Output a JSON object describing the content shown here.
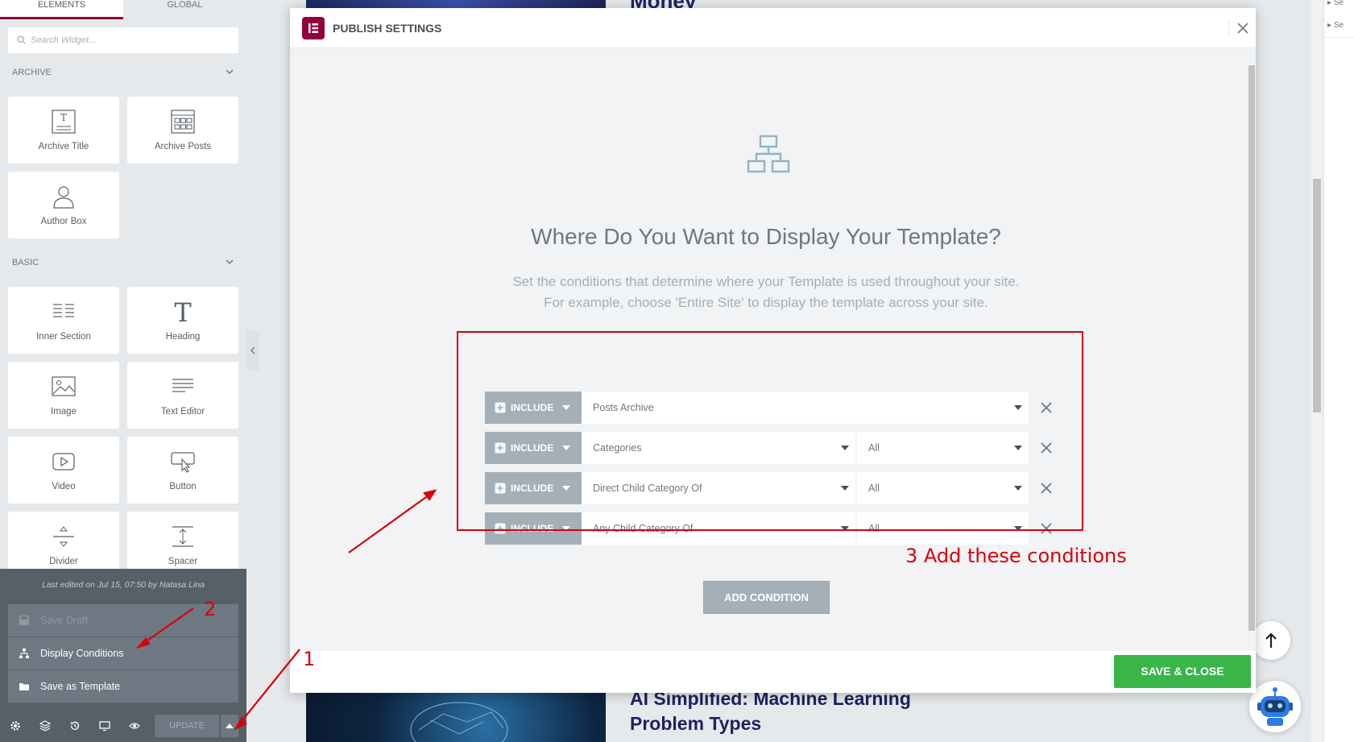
{
  "left_panel": {
    "tabs": [
      {
        "label": "Elements",
        "active": true
      },
      {
        "label": "Global",
        "active": false
      }
    ],
    "search_placeholder": "Search Widget...",
    "categories": [
      {
        "label": "Archive",
        "widgets": [
          {
            "label": "Archive Title",
            "icon": "archive-title-icon"
          },
          {
            "label": "Archive Posts",
            "icon": "archive-posts-icon"
          },
          {
            "label": "Author Box",
            "icon": "author-box-icon"
          }
        ]
      },
      {
        "label": "Basic",
        "widgets": [
          {
            "label": "Inner Section",
            "icon": "inner-section-icon"
          },
          {
            "label": "Heading",
            "icon": "heading-icon"
          },
          {
            "label": "Image",
            "icon": "image-icon"
          },
          {
            "label": "Text Editor",
            "icon": "text-editor-icon"
          },
          {
            "label": "Video",
            "icon": "video-icon"
          },
          {
            "label": "Button",
            "icon": "button-icon"
          },
          {
            "label": "Divider",
            "icon": "divider-icon"
          },
          {
            "label": "Spacer",
            "icon": "spacer-icon"
          }
        ]
      }
    ],
    "footer_menu": {
      "last_edited": "Last edited on Jul 15, 07:50 by Natasa Lina",
      "items": [
        {
          "label": "Save Draft",
          "disabled": true
        },
        {
          "label": "Display Conditions",
          "disabled": false
        },
        {
          "label": "Save as Template",
          "disabled": false
        }
      ]
    },
    "bottom_bar": {
      "update_label": "Update"
    }
  },
  "preview": {
    "top_title": "Money",
    "card_title": "AI Simplified: Machine Learning Problem Types",
    "right_strip_items": [
      "Se",
      "Se"
    ]
  },
  "modal": {
    "title": "Publish Settings",
    "heading": "Where Do You Want to Display Your Template?",
    "subtext_line1": "Set the conditions that determine where your Template is used throughout your site.",
    "subtext_line2": "For example, choose 'Entire Site' to display the template across your site.",
    "conditions": [
      {
        "type": "Include",
        "main": "Posts Archive",
        "sub": ""
      },
      {
        "type": "Include",
        "main": "Categories",
        "sub": "All"
      },
      {
        "type": "Include",
        "main": "Direct Child Category Of",
        "sub": "All"
      },
      {
        "type": "Include",
        "main": "Any Child Category Of",
        "sub": "All"
      }
    ],
    "add_condition_label": "Add Condition",
    "save_close_label": "Save & Close"
  },
  "annotations": {
    "label_1": "1",
    "label_2": "2",
    "label_3": "3 Add these conditions"
  },
  "colors": {
    "brand": "#93003c",
    "accent_green": "#39b54a",
    "annotation_red": "#d8000c",
    "panel_dark": "#556068"
  }
}
